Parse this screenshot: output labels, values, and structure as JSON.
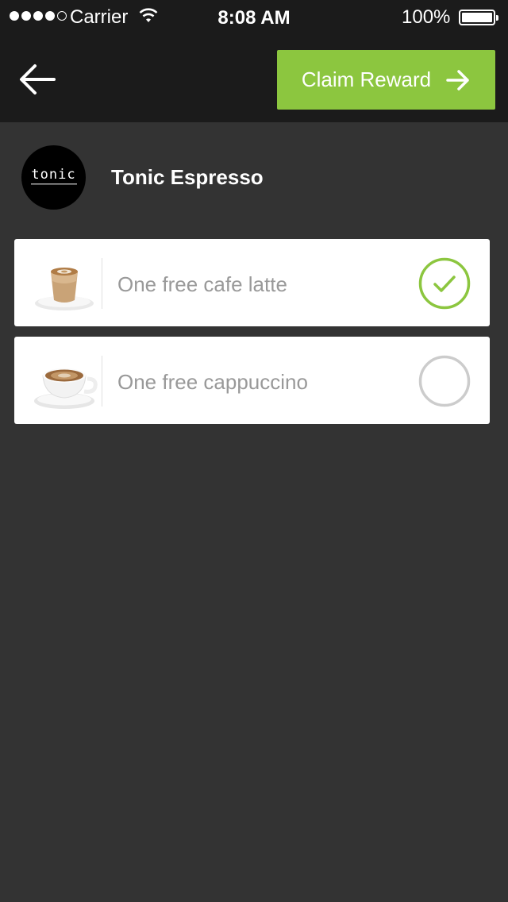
{
  "status_bar": {
    "carrier": "Carrier",
    "time": "8:08 AM",
    "battery": "100%",
    "signal_bars_filled": 4,
    "signal_bars_total": 5
  },
  "header": {
    "back_icon": "arrow-left-icon",
    "claim_label": "Claim Reward",
    "claim_icon": "arrow-right-icon",
    "accent_color": "#8cc63f"
  },
  "merchant": {
    "name": "Tonic Espresso",
    "logo_text": "tonic"
  },
  "rewards": [
    {
      "label": "One free cafe latte",
      "icon": "cafe-latte-image",
      "selected": true
    },
    {
      "label": "One free cappuccino",
      "icon": "cappuccino-image",
      "selected": false
    }
  ],
  "colors": {
    "header_bg": "#1b1b1b",
    "page_bg": "#333333",
    "selected_check": "#8cc63f",
    "unselected_ring": "#cccccc"
  }
}
